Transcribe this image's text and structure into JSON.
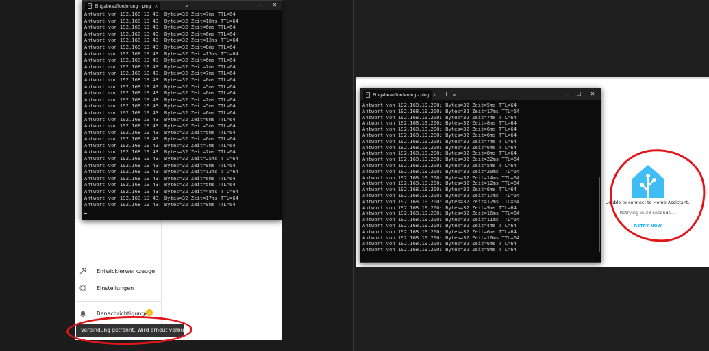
{
  "left_terminal": {
    "tab_title": "Eingabeaufforderung - ping",
    "tab_icon": "C:\\",
    "tab_close": "×",
    "new_tab": "+",
    "dropdown": "⌄",
    "window_controls": {
      "minimize": "—",
      "close": "✕"
    },
    "lines": [
      "Antwort von 192.168.19.43: Bytes=32 Zeit=7ms TTL=64",
      "Antwort von 192.168.19.43: Bytes=32 Zeit=18ms TTL=64",
      "Antwort von 192.168.19.43: Bytes=32 Zeit=6ms TTL=64",
      "Antwort von 192.168.19.43: Bytes=32 Zeit=6ms TTL=64",
      "Antwort von 192.168.19.43: Bytes=32 Zeit=13ms TTL=64",
      "Antwort von 192.168.19.43: Bytes=32 Zeit=8ms TTL=64",
      "Antwort von 192.168.19.43: Bytes=32 Zeit=13ms TTL=64",
      "Antwort von 192.168.19.43: Bytes=32 Zeit=6ms TTL=64",
      "Antwort von 192.168.19.43: Bytes=32 Zeit=7ms TTL=64",
      "Antwort von 192.168.19.43: Bytes=32 Zeit=7ms TTL=64",
      "Antwort von 192.168.19.43: Bytes=32 Zeit=6ms TTL=64",
      "Antwort von 192.168.19.43: Bytes=32 Zeit=5ms TTL=64",
      "Antwort von 192.168.19.43: Bytes=32 Zeit=6ms TTL=64",
      "Antwort von 192.168.19.43: Bytes=32 Zeit=7ms TTL=64",
      "Antwort von 192.168.19.43: Bytes=32 Zeit=5ms TTL=64",
      "Antwort von 192.168.19.43: Bytes=32 Zeit=6ms TTL=64",
      "Antwort von 192.168.19.43: Bytes=32 Zeit=6ms TTL=64",
      "Antwort von 192.168.19.43: Bytes=32 Zeit=5ms TTL=64",
      "Antwort von 192.168.19.43: Bytes=32 Zeit=5ms TTL=64",
      "Antwort von 192.168.19.43: Bytes=32 Zeit=6ms TTL=64",
      "Antwort von 192.168.19.43: Bytes=32 Zeit=7ms TTL=64",
      "Antwort von 192.168.19.43: Bytes=32 Zeit=7ms TTL=64",
      "Antwort von 192.168.19.43: Bytes=32 Zeit=25ms TTL=64",
      "Antwort von 192.168.19.43: Bytes=32 Zeit=8ms TTL=64",
      "Antwort von 192.168.19.43: Bytes=32 Zeit=12ms TTL=64",
      "Antwort von 192.168.19.43: Bytes=32 Zeit=6ms TTL=64",
      "Antwort von 192.168.19.43: Bytes=32 Zeit=5ms TTL=64",
      "Antwort von 192.168.19.43: Bytes=32 Zeit=48ms TTL=64",
      "Antwort von 192.168.19.43: Bytes=32 Zeit=17ms TTL=64",
      "Antwort von 192.168.19.43: Bytes=32 Zeit=8ms TTL=64"
    ]
  },
  "right_terminal": {
    "tab_title": "Eingabeaufforderung - ping",
    "tab_icon": "C:\\",
    "tab_close": "×",
    "new_tab": "+",
    "dropdown": "⌄",
    "window_controls": {
      "minimize": "—",
      "maximize": "☐",
      "close": "✕"
    },
    "lines": [
      "Antwort von 192.168.19.200: Bytes=32 Zeit=5ms TTL=64",
      "Antwort von 192.168.19.200: Bytes=32 Zeit=17ms TTL=64",
      "Antwort von 192.168.19.200: Bytes=32 Zeit=7ms TTL=64",
      "Antwort von 192.168.19.200: Bytes=32 Zeit=8ms TTL=64",
      "Antwort von 192.168.19.200: Bytes=32 Zeit=6ms TTL=64",
      "Antwort von 192.168.19.200: Bytes=32 Zeit=6ms TTL=64",
      "Antwort von 192.168.19.200: Bytes=32 Zeit=7ms TTL=64",
      "Antwort von 192.168.19.200: Bytes=32 Zeit=6ms TTL=64",
      "Antwort von 192.168.19.200: Bytes=32 Zeit=8ms TTL=64",
      "Antwort von 192.168.19.200: Bytes=32 Zeit=22ms TTL=64",
      "Antwort von 192.168.19.200: Bytes=32 Zeit=5ms TTL=64",
      "Antwort von 192.168.19.200: Bytes=32 Zeit=20ms TTL=64",
      "Antwort von 192.168.19.200: Bytes=32 Zeit=14ms TTL=64",
      "Antwort von 192.168.19.200: Bytes=32 Zeit=12ms TTL=64",
      "Antwort von 192.168.19.200: Bytes=32 Zeit=6ms TTL=64",
      "Antwort von 192.168.19.200: Bytes=32 Zeit=17ms TTL=64",
      "Antwort von 192.168.19.200: Bytes=32 Zeit=12ms TTL=64",
      "Antwort von 192.168.19.200: Bytes=32 Zeit=9ms TTL=64",
      "Antwort von 192.168.19.200: Bytes=32 Zeit=16ms TTL=64",
      "Antwort von 192.168.19.200: Bytes=32 Zeit=11ms TTL=64",
      "Antwort von 192.168.19.200: Bytes=32 Zeit=4ms TTL=64",
      "Antwort von 192.168.19.200: Bytes=32 Zeit=6ms TTL=64",
      "Antwort von 192.168.19.200: Bytes=32 Zeit=10ms TTL=64",
      "Antwort von 192.168.19.200: Bytes=32 Zeit=6ms TTL=64",
      "Antwort von 192.168.19.200: Bytes=32 Zeit=9ms TTL=64"
    ]
  },
  "sidebar": {
    "items": [
      {
        "label": "Entwicklerwerkzeuge",
        "icon": "hammer-icon"
      },
      {
        "label": "Einstellungen",
        "icon": "gear-icon"
      },
      {
        "label": "Benachrichtigungen",
        "icon": "bell-icon"
      }
    ],
    "notification_count": "1"
  },
  "toast": {
    "message": "Verbindung getrennt. Wird erneut verbunden..."
  },
  "ha_error": {
    "message": "Unable to connect to Home Assistant.",
    "retry_status": "Retrying in 38 seconds...",
    "retry_button": "RETRY NOW"
  },
  "colors": {
    "ha_blue": "#41bdf5",
    "annotation_red": "#e0161b",
    "terminal_bg": "#0c0c0c",
    "badge_yellow": "#f4b400"
  }
}
